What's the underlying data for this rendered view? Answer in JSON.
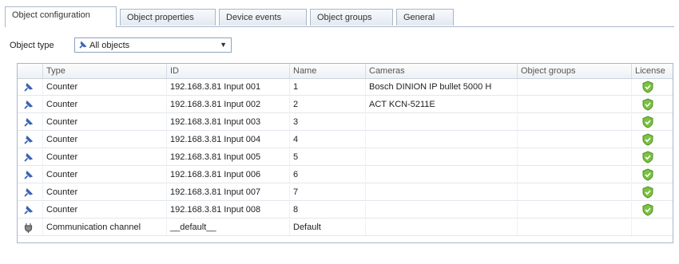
{
  "tabs": [
    {
      "label": "Object configuration",
      "active": true
    },
    {
      "label": "Object properties",
      "active": false
    },
    {
      "label": "Device events",
      "active": false
    },
    {
      "label": "Object groups",
      "active": false
    },
    {
      "label": "General",
      "active": false
    }
  ],
  "filter": {
    "label": "Object type",
    "selected_value": "All objects",
    "selected_icon": "pin-icon"
  },
  "table": {
    "columns": [
      "Type",
      "ID",
      "Name",
      "Cameras",
      "Object groups",
      "License"
    ],
    "rows": [
      {
        "type": "Counter",
        "id": "192.168.3.81 Input 001",
        "name": "1",
        "cameras": "Bosch DINION IP bullet 5000 H",
        "object_groups": "",
        "icon": "counter-pin-icon",
        "license": "license-shield-icon"
      },
      {
        "type": "Counter",
        "id": "192.168.3.81 Input 002",
        "name": "2",
        "cameras": "ACT KCN-5211E",
        "object_groups": "",
        "icon": "counter-pin-icon",
        "license": "license-shield-icon"
      },
      {
        "type": "Counter",
        "id": "192.168.3.81 Input 003",
        "name": "3",
        "cameras": "",
        "object_groups": "",
        "icon": "counter-pin-icon",
        "license": "license-shield-icon"
      },
      {
        "type": "Counter",
        "id": "192.168.3.81 Input 004",
        "name": "4",
        "cameras": "",
        "object_groups": "",
        "icon": "counter-pin-icon",
        "license": "license-shield-icon"
      },
      {
        "type": "Counter",
        "id": "192.168.3.81 Input 005",
        "name": "5",
        "cameras": "",
        "object_groups": "",
        "icon": "counter-pin-icon",
        "license": "license-shield-icon"
      },
      {
        "type": "Counter",
        "id": "192.168.3.81 Input 006",
        "name": "6",
        "cameras": "",
        "object_groups": "",
        "icon": "counter-pin-icon",
        "license": "license-shield-icon"
      },
      {
        "type": "Counter",
        "id": "192.168.3.81 Input 007",
        "name": "7",
        "cameras": "",
        "object_groups": "",
        "icon": "counter-pin-icon",
        "license": "license-shield-icon"
      },
      {
        "type": "Counter",
        "id": "192.168.3.81 Input 008",
        "name": "8",
        "cameras": "",
        "object_groups": "",
        "icon": "counter-pin-icon",
        "license": "license-shield-icon"
      },
      {
        "type": "Communication channel",
        "id": "__default__",
        "name": "Default",
        "cameras": "",
        "object_groups": "",
        "icon": "plug-icon",
        "license": ""
      }
    ]
  },
  "colors": {
    "tab_border": "#a9b7c9",
    "pin_blue": "#3a62b8",
    "license_green": "#7cc242"
  }
}
